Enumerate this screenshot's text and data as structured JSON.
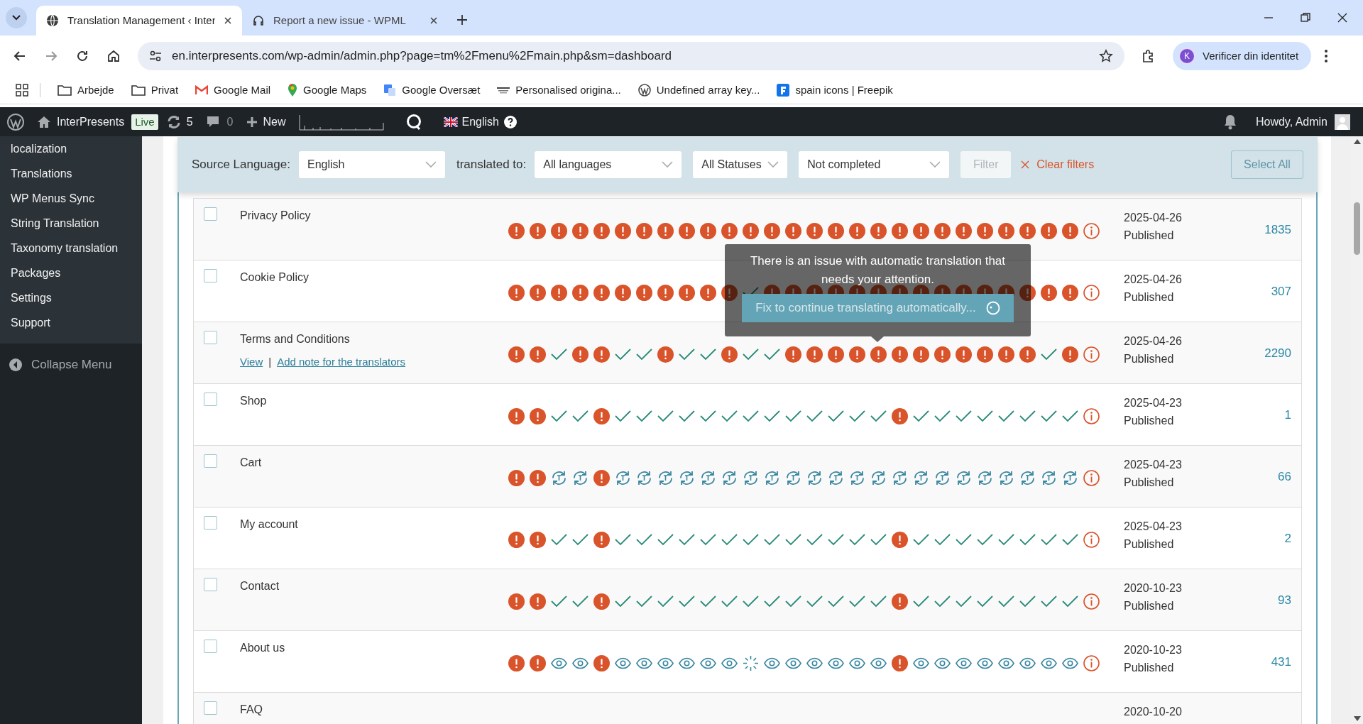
{
  "browser": {
    "tabs": [
      {
        "title": "Translation Management ‹ Inter",
        "selected": true
      },
      {
        "title": "Report a new issue - WPML",
        "selected": false
      }
    ],
    "address": "en.interpresents.com/wp-admin/admin.php?page=tm%2Fmenu%2Fmain.php&sm=dashboard",
    "profile_initial": "K",
    "profile": "Verificer din identitet",
    "bookmarks": [
      {
        "label": "Arbejde",
        "kind": "folder"
      },
      {
        "label": "Privat",
        "kind": "folder"
      },
      {
        "label": "Google Mail",
        "kind": "mail"
      },
      {
        "label": "Google Maps",
        "kind": "maps"
      },
      {
        "label": "Google Oversæt",
        "kind": "translate"
      },
      {
        "label": "Personalised origina...",
        "kind": "site"
      },
      {
        "label": "Undefined array key...",
        "kind": "wordpress"
      },
      {
        "label": "spain icons | Freepik",
        "kind": "freepik"
      }
    ]
  },
  "admin_bar": {
    "site": "InterPresents",
    "badge": "Live",
    "updates": "5",
    "comments": "0",
    "new": "New",
    "language": "English",
    "greeting": "Howdy, Admin"
  },
  "sidebar": {
    "items": [
      {
        "label": "localization"
      },
      {
        "label": "Translations"
      },
      {
        "label": "WP Menus Sync"
      },
      {
        "label": "String Translation"
      },
      {
        "label": "Taxonomy translation"
      },
      {
        "label": "Packages"
      },
      {
        "label": "Settings"
      },
      {
        "label": "Support"
      }
    ],
    "collapse": "Collapse Menu"
  },
  "filters": {
    "source_label": "Source Language:",
    "source": "English",
    "target_label": "translated to:",
    "target": "All languages",
    "status": "All Statuses",
    "completion": "Not completed",
    "filter_button": {
      "label": "Filter",
      "disabled": true
    },
    "clear": "Clear filters",
    "select_all": {
      "label": "Select All",
      "disabled": true
    }
  },
  "rows": [
    {
      "title": "Privacy Policy",
      "checked": false,
      "statuses": [
        {
          "kind": "fix"
        },
        {
          "kind": "fix"
        },
        {
          "kind": "fix"
        },
        {
          "kind": "fix"
        },
        {
          "kind": "fix"
        },
        {
          "kind": "fix"
        },
        {
          "kind": "fix"
        },
        {
          "kind": "fix"
        },
        {
          "kind": "fix"
        },
        {
          "kind": "fix"
        },
        {
          "kind": "fix"
        },
        {
          "kind": "fix"
        },
        {
          "kind": "fix"
        },
        {
          "kind": "fix"
        },
        {
          "kind": "fix"
        },
        {
          "kind": "fix"
        },
        {
          "kind": "fix"
        },
        {
          "kind": "fix"
        },
        {
          "kind": "fix"
        },
        {
          "kind": "fix"
        },
        {
          "kind": "fix"
        },
        {
          "kind": "fix"
        },
        {
          "kind": "fix"
        },
        {
          "kind": "fix"
        },
        {
          "kind": "fix"
        },
        {
          "kind": "fix"
        },
        {
          "kind": "fix"
        }
      ],
      "date": "2025-04-26",
      "state": "Published",
      "count": "1835"
    },
    {
      "title": "Cookie Policy",
      "checked": false,
      "statuses": [
        {
          "kind": "fix"
        },
        {
          "kind": "fix"
        },
        {
          "kind": "fix"
        },
        {
          "kind": "fix"
        },
        {
          "kind": "fix"
        },
        {
          "kind": "fix"
        },
        {
          "kind": "fix"
        },
        {
          "kind": "fix"
        },
        {
          "kind": "fix"
        },
        {
          "kind": "fix"
        },
        {
          "kind": "fix"
        },
        {
          "kind": "done"
        },
        {
          "kind": "fix"
        },
        {
          "kind": "fix"
        },
        {
          "kind": "fix"
        },
        {
          "kind": "fix"
        },
        {
          "kind": "fix"
        },
        {
          "kind": "fix"
        },
        {
          "kind": "fix"
        },
        {
          "kind": "fix"
        },
        {
          "kind": "fix"
        },
        {
          "kind": "fix"
        },
        {
          "kind": "fix"
        },
        {
          "kind": "fix"
        },
        {
          "kind": "fix"
        },
        {
          "kind": "fix"
        },
        {
          "kind": "fix"
        }
      ],
      "date": "2025-04-26",
      "state": "Published",
      "count": "307"
    },
    {
      "title": "Terms and Conditions",
      "checked": false,
      "links": [
        "View",
        "Add note for the translators"
      ],
      "separator": "|",
      "statuses": [
        {
          "kind": "fix"
        },
        {
          "kind": "fix"
        },
        {
          "kind": "done"
        },
        {
          "kind": "fix"
        },
        {
          "kind": "fix"
        },
        {
          "kind": "done"
        },
        {
          "kind": "done"
        },
        {
          "kind": "fix"
        },
        {
          "kind": "done"
        },
        {
          "kind": "done"
        },
        {
          "kind": "fix"
        },
        {
          "kind": "done"
        },
        {
          "kind": "done"
        },
        {
          "kind": "fix"
        },
        {
          "kind": "fix"
        },
        {
          "kind": "fix"
        },
        {
          "kind": "fix"
        },
        {
          "kind": "fix"
        },
        {
          "kind": "fix"
        },
        {
          "kind": "fix"
        },
        {
          "kind": "fix"
        },
        {
          "kind": "fix"
        },
        {
          "kind": "fix"
        },
        {
          "kind": "fix"
        },
        {
          "kind": "fix"
        },
        {
          "kind": "done"
        },
        {
          "kind": "fix"
        }
      ],
      "date": "2025-04-26",
      "state": "Published",
      "count": "2290"
    },
    {
      "title": "Shop",
      "checked": false,
      "statuses": [
        {
          "kind": "fix"
        },
        {
          "kind": "fix"
        },
        {
          "kind": "done"
        },
        {
          "kind": "done"
        },
        {
          "kind": "fix"
        },
        {
          "kind": "done"
        },
        {
          "kind": "done"
        },
        {
          "kind": "done"
        },
        {
          "kind": "done"
        },
        {
          "kind": "done"
        },
        {
          "kind": "done"
        },
        {
          "kind": "done"
        },
        {
          "kind": "done"
        },
        {
          "kind": "done"
        },
        {
          "kind": "done"
        },
        {
          "kind": "done"
        },
        {
          "kind": "done"
        },
        {
          "kind": "done"
        },
        {
          "kind": "fix"
        },
        {
          "kind": "done"
        },
        {
          "kind": "done"
        },
        {
          "kind": "done"
        },
        {
          "kind": "done"
        },
        {
          "kind": "done"
        },
        {
          "kind": "done"
        },
        {
          "kind": "done"
        },
        {
          "kind": "done"
        }
      ],
      "date": "2025-04-23",
      "state": "Published",
      "count": "1"
    },
    {
      "title": "Cart",
      "checked": false,
      "statuses": [
        {
          "kind": "fix"
        },
        {
          "kind": "fix"
        },
        {
          "kind": "sync"
        },
        {
          "kind": "sync"
        },
        {
          "kind": "fix"
        },
        {
          "kind": "sync"
        },
        {
          "kind": "sync"
        },
        {
          "kind": "sync"
        },
        {
          "kind": "sync"
        },
        {
          "kind": "sync"
        },
        {
          "kind": "sync"
        },
        {
          "kind": "sync"
        },
        {
          "kind": "sync"
        },
        {
          "kind": "sync"
        },
        {
          "kind": "sync"
        },
        {
          "kind": "sync"
        },
        {
          "kind": "sync"
        },
        {
          "kind": "sync"
        },
        {
          "kind": "sync"
        },
        {
          "kind": "sync"
        },
        {
          "kind": "sync"
        },
        {
          "kind": "sync"
        },
        {
          "kind": "sync"
        },
        {
          "kind": "sync"
        },
        {
          "kind": "sync"
        },
        {
          "kind": "sync"
        },
        {
          "kind": "sync"
        }
      ],
      "date": "2025-04-23",
      "state": "Published",
      "count": "66"
    },
    {
      "title": "My account",
      "checked": false,
      "statuses": [
        {
          "kind": "fix"
        },
        {
          "kind": "fix"
        },
        {
          "kind": "done"
        },
        {
          "kind": "done"
        },
        {
          "kind": "fix"
        },
        {
          "kind": "done"
        },
        {
          "kind": "done"
        },
        {
          "kind": "done"
        },
        {
          "kind": "done"
        },
        {
          "kind": "done"
        },
        {
          "kind": "done"
        },
        {
          "kind": "done"
        },
        {
          "kind": "done"
        },
        {
          "kind": "done"
        },
        {
          "kind": "done"
        },
        {
          "kind": "done"
        },
        {
          "kind": "done"
        },
        {
          "kind": "done"
        },
        {
          "kind": "fix"
        },
        {
          "kind": "done"
        },
        {
          "kind": "done"
        },
        {
          "kind": "done"
        },
        {
          "kind": "done"
        },
        {
          "kind": "done"
        },
        {
          "kind": "done"
        },
        {
          "kind": "done"
        },
        {
          "kind": "done"
        }
      ],
      "date": "2025-04-23",
      "state": "Published",
      "count": "2"
    },
    {
      "title": "Contact",
      "checked": false,
      "statuses": [
        {
          "kind": "fix"
        },
        {
          "kind": "fix"
        },
        {
          "kind": "done"
        },
        {
          "kind": "done"
        },
        {
          "kind": "fix"
        },
        {
          "kind": "done"
        },
        {
          "kind": "done"
        },
        {
          "kind": "done"
        },
        {
          "kind": "done"
        },
        {
          "kind": "done"
        },
        {
          "kind": "done"
        },
        {
          "kind": "done"
        },
        {
          "kind": "done"
        },
        {
          "kind": "done"
        },
        {
          "kind": "done"
        },
        {
          "kind": "done"
        },
        {
          "kind": "done"
        },
        {
          "kind": "done"
        },
        {
          "kind": "fix"
        },
        {
          "kind": "done"
        },
        {
          "kind": "done"
        },
        {
          "kind": "done"
        },
        {
          "kind": "done"
        },
        {
          "kind": "done"
        },
        {
          "kind": "done"
        },
        {
          "kind": "done"
        },
        {
          "kind": "done"
        }
      ],
      "date": "2020-10-23",
      "state": "Published",
      "count": "93"
    },
    {
      "title": "About us",
      "checked": false,
      "statuses": [
        {
          "kind": "fix"
        },
        {
          "kind": "fix"
        },
        {
          "kind": "review"
        },
        {
          "kind": "review"
        },
        {
          "kind": "fix"
        },
        {
          "kind": "review"
        },
        {
          "kind": "review"
        },
        {
          "kind": "review"
        },
        {
          "kind": "review"
        },
        {
          "kind": "review"
        },
        {
          "kind": "review"
        },
        {
          "kind": "progress"
        },
        {
          "kind": "review"
        },
        {
          "kind": "review"
        },
        {
          "kind": "review"
        },
        {
          "kind": "review"
        },
        {
          "kind": "review"
        },
        {
          "kind": "review"
        },
        {
          "kind": "fix"
        },
        {
          "kind": "review"
        },
        {
          "kind": "review"
        },
        {
          "kind": "review"
        },
        {
          "kind": "review"
        },
        {
          "kind": "review"
        },
        {
          "kind": "review"
        },
        {
          "kind": "review"
        },
        {
          "kind": "review"
        }
      ],
      "date": "2020-10-23",
      "state": "Published",
      "count": "431"
    },
    {
      "title": "FAQ",
      "checked": false,
      "date": "2020-10-20"
    }
  ],
  "tooltip": {
    "message": "There is an issue with automatic translation that needs your attention.",
    "action": "Fix to continue translating automatically..."
  }
}
